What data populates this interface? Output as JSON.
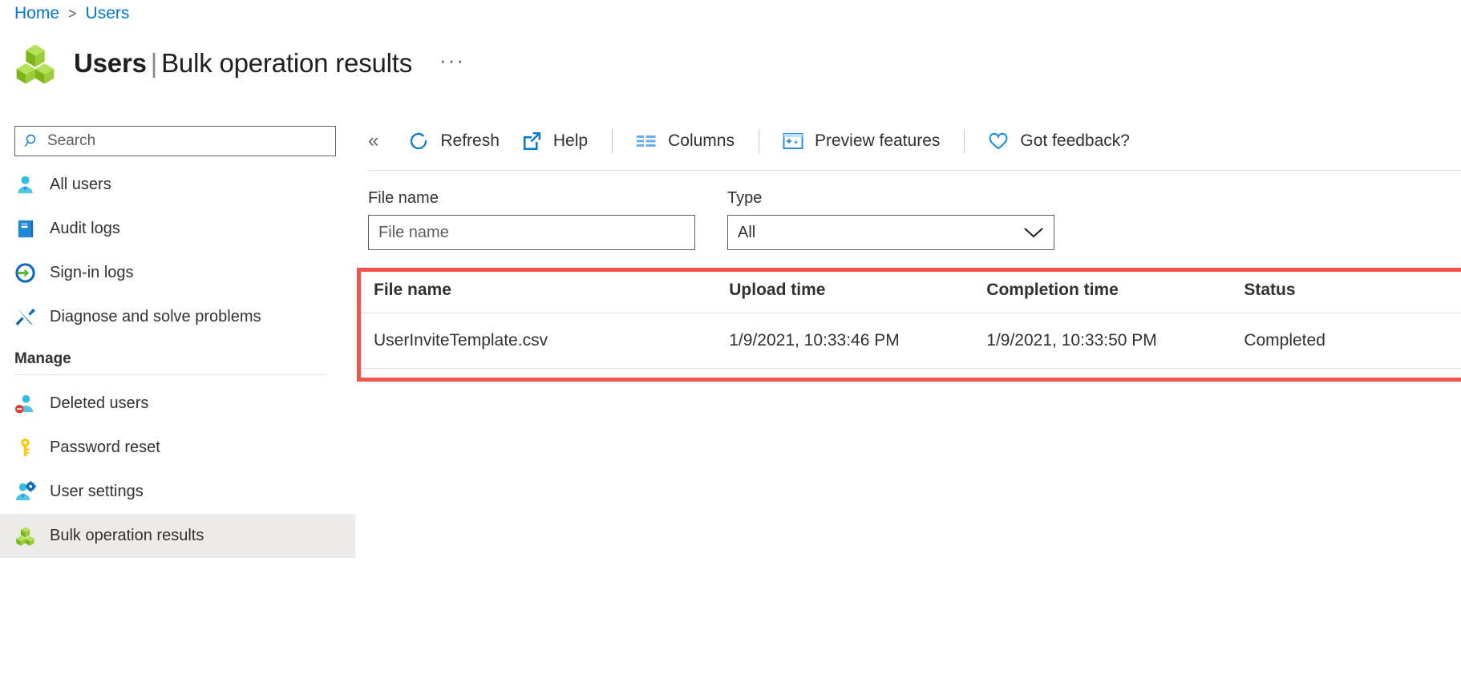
{
  "breadcrumb": {
    "items": [
      "Home",
      "Users"
    ],
    "separator": ">"
  },
  "header": {
    "icon": "bulk-operations-cubes-icon",
    "title_main": "Users",
    "title_divider": "|",
    "title_sub": "Bulk operation results",
    "more_menu": "···"
  },
  "sidebar": {
    "search": {
      "placeholder": "Search",
      "value": "",
      "icon": "search-icon"
    },
    "collapse_icon": "«",
    "items": [
      {
        "label": "All users",
        "icon": "user-icon",
        "selected": false
      },
      {
        "label": "Audit logs",
        "icon": "audit-log-book-icon",
        "selected": false
      },
      {
        "label": "Sign-in logs",
        "icon": "sign-in-arrow-icon",
        "selected": false
      },
      {
        "label": "Diagnose and solve problems",
        "icon": "wrench-screwdriver-icon",
        "selected": false
      }
    ],
    "group": {
      "label": "Manage",
      "items": [
        {
          "label": "Deleted users",
          "icon": "deleted-user-icon",
          "selected": false
        },
        {
          "label": "Password reset",
          "icon": "key-icon",
          "selected": false
        },
        {
          "label": "User settings",
          "icon": "user-settings-icon",
          "selected": false
        },
        {
          "label": "Bulk operation results",
          "icon": "bulk-operations-cubes-icon",
          "selected": true
        }
      ]
    }
  },
  "toolbar": {
    "refresh_label": "Refresh",
    "help_label": "Help",
    "columns_label": "Columns",
    "preview_features_label": "Preview features",
    "feedback_label": "Got feedback?"
  },
  "filters": {
    "file_name": {
      "label": "File name",
      "placeholder": "File name",
      "value": ""
    },
    "type": {
      "label": "Type",
      "selected": "All",
      "options": [
        "All"
      ]
    }
  },
  "results_table": {
    "columns": [
      "File name",
      "Upload time",
      "Completion time",
      "Status"
    ],
    "rows": [
      {
        "file_name": "UserInviteTemplate.csv",
        "upload_time": "1/9/2021, 10:33:46 PM",
        "completion_time": "1/9/2021, 10:33:50 PM",
        "status": "Completed"
      }
    ],
    "highlight_color": "#f4534d"
  },
  "colors": {
    "link_blue": "#0078d4",
    "accent_blue": "#50a0e0",
    "highlight_red": "#f4534d",
    "selected_row_bg": "#edebe9",
    "cube_green": "#8cc63f"
  }
}
